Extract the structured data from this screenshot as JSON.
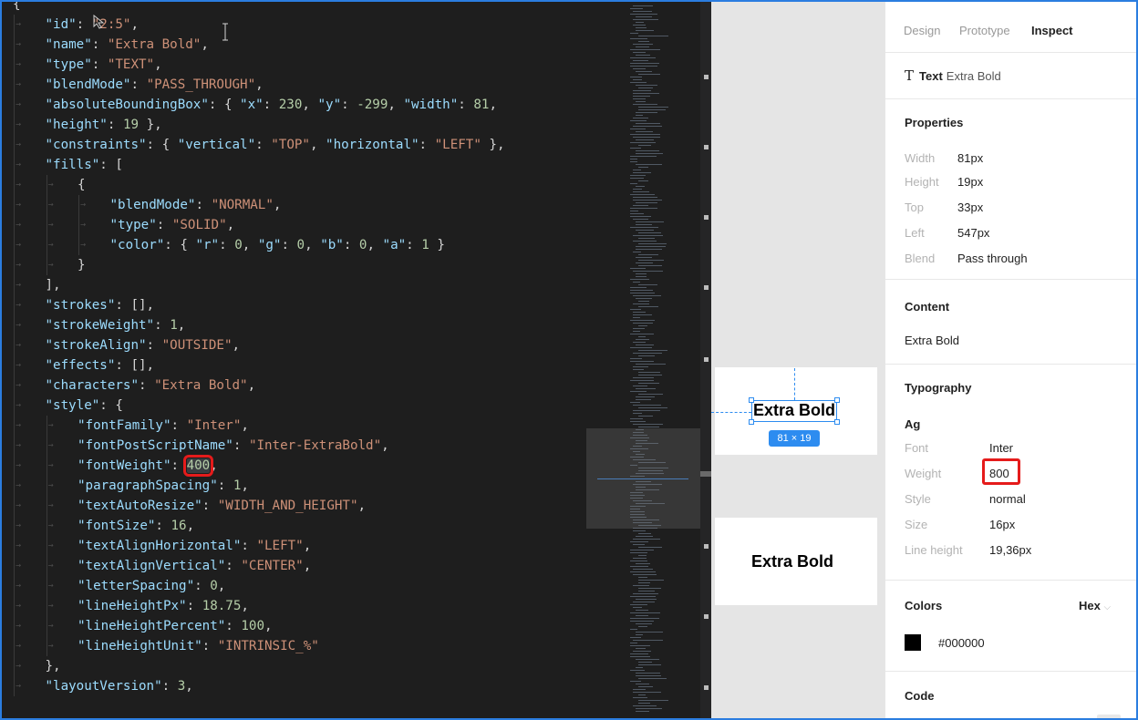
{
  "editor": {
    "lines": [
      {
        "indent": 0,
        "tokens": [
          [
            "{",
            "p"
          ]
        ]
      },
      {
        "indent": 1,
        "tokens": [
          [
            "\"id\"",
            "k"
          ],
          [
            ": ",
            "p"
          ],
          [
            "\"2:5\"",
            "s"
          ],
          [
            ",",
            "p"
          ]
        ]
      },
      {
        "indent": 1,
        "tokens": [
          [
            "\"name\"",
            "k"
          ],
          [
            ": ",
            "p"
          ],
          [
            "\"Extra Bold\"",
            "s"
          ],
          [
            ",",
            "p"
          ]
        ]
      },
      {
        "indent": 1,
        "tokens": [
          [
            "\"type\"",
            "k"
          ],
          [
            ": ",
            "p"
          ],
          [
            "\"TEXT\"",
            "s"
          ],
          [
            ",",
            "p"
          ]
        ]
      },
      {
        "indent": 1,
        "tokens": [
          [
            "\"blendMode\"",
            "k"
          ],
          [
            ": ",
            "p"
          ],
          [
            "\"PASS_THROUGH\"",
            "s"
          ],
          [
            ",",
            "p"
          ]
        ]
      },
      {
        "indent": 1,
        "tokens": [
          [
            "\"absoluteBoundingBox\"",
            "k"
          ],
          [
            ": { ",
            "p"
          ],
          [
            "\"x\"",
            "k"
          ],
          [
            ": ",
            "p"
          ],
          [
            "230",
            "n"
          ],
          [
            ", ",
            "p"
          ],
          [
            "\"y\"",
            "k"
          ],
          [
            ": ",
            "p"
          ],
          [
            "-299",
            "n"
          ],
          [
            ", ",
            "p"
          ],
          [
            "\"width\"",
            "k"
          ],
          [
            ": ",
            "p"
          ],
          [
            "81",
            "n"
          ],
          [
            ",",
            "p"
          ]
        ]
      },
      {
        "indent": 1,
        "tokens": [
          [
            "\"height\"",
            "k"
          ],
          [
            ": ",
            "p"
          ],
          [
            "19",
            "n"
          ],
          [
            " },",
            "p"
          ]
        ]
      },
      {
        "indent": 1,
        "tokens": [
          [
            "\"constraints\"",
            "k"
          ],
          [
            ": { ",
            "p"
          ],
          [
            "\"vertical\"",
            "k"
          ],
          [
            ": ",
            "p"
          ],
          [
            "\"TOP\"",
            "s"
          ],
          [
            ", ",
            "p"
          ],
          [
            "\"horizontal\"",
            "k"
          ],
          [
            ": ",
            "p"
          ],
          [
            "\"LEFT\"",
            "s"
          ],
          [
            " },",
            "p"
          ]
        ]
      },
      {
        "indent": 1,
        "tokens": [
          [
            "\"fills\"",
            "k"
          ],
          [
            ": [",
            "p"
          ]
        ]
      },
      {
        "indent": 2,
        "tokens": [
          [
            "{",
            "p"
          ]
        ]
      },
      {
        "indent": 3,
        "tokens": [
          [
            "\"blendMode\"",
            "k"
          ],
          [
            ": ",
            "p"
          ],
          [
            "\"NORMAL\"",
            "s"
          ],
          [
            ",",
            "p"
          ]
        ]
      },
      {
        "indent": 3,
        "tokens": [
          [
            "\"type\"",
            "k"
          ],
          [
            ": ",
            "p"
          ],
          [
            "\"SOLID\"",
            "s"
          ],
          [
            ",",
            "p"
          ]
        ]
      },
      {
        "indent": 3,
        "tokens": [
          [
            "\"color\"",
            "k"
          ],
          [
            ": { ",
            "p"
          ],
          [
            "\"r\"",
            "k"
          ],
          [
            ": ",
            "p"
          ],
          [
            "0",
            "n"
          ],
          [
            ", ",
            "p"
          ],
          [
            "\"g\"",
            "k"
          ],
          [
            ": ",
            "p"
          ],
          [
            "0",
            "n"
          ],
          [
            ", ",
            "p"
          ],
          [
            "\"b\"",
            "k"
          ],
          [
            ": ",
            "p"
          ],
          [
            "0",
            "n"
          ],
          [
            ", ",
            "p"
          ],
          [
            "\"a\"",
            "k"
          ],
          [
            ": ",
            "p"
          ],
          [
            "1",
            "n"
          ],
          [
            " }",
            "p"
          ]
        ]
      },
      {
        "indent": 2,
        "tokens": [
          [
            "}",
            "p"
          ]
        ]
      },
      {
        "indent": 1,
        "tokens": [
          [
            "],",
            "p"
          ]
        ]
      },
      {
        "indent": 1,
        "tokens": [
          [
            "\"strokes\"",
            "k"
          ],
          [
            ": [],",
            "p"
          ]
        ]
      },
      {
        "indent": 1,
        "tokens": [
          [
            "\"strokeWeight\"",
            "k"
          ],
          [
            ": ",
            "p"
          ],
          [
            "1",
            "n"
          ],
          [
            ",",
            "p"
          ]
        ]
      },
      {
        "indent": 1,
        "tokens": [
          [
            "\"strokeAlign\"",
            "k"
          ],
          [
            ": ",
            "p"
          ],
          [
            "\"OUTSIDE\"",
            "s"
          ],
          [
            ",",
            "p"
          ]
        ]
      },
      {
        "indent": 1,
        "tokens": [
          [
            "\"effects\"",
            "k"
          ],
          [
            ": [],",
            "p"
          ]
        ]
      },
      {
        "indent": 1,
        "tokens": [
          [
            "\"characters\"",
            "k"
          ],
          [
            ": ",
            "p"
          ],
          [
            "\"Extra Bold\"",
            "s"
          ],
          [
            ",",
            "p"
          ]
        ]
      },
      {
        "indent": 1,
        "tokens": [
          [
            "\"style\"",
            "k"
          ],
          [
            ": {",
            "p"
          ]
        ]
      },
      {
        "indent": 2,
        "tokens": [
          [
            "\"fontFamily\"",
            "k"
          ],
          [
            ": ",
            "p"
          ],
          [
            "\"Inter\"",
            "s"
          ],
          [
            ",",
            "p"
          ]
        ]
      },
      {
        "indent": 2,
        "tokens": [
          [
            "\"fontPostScriptName\"",
            "k"
          ],
          [
            ": ",
            "p"
          ],
          [
            "\"Inter-ExtraBold\"",
            "s"
          ],
          [
            ",",
            "p"
          ]
        ]
      },
      {
        "indent": 2,
        "tokens": [
          [
            "\"fontWeight\"",
            "k"
          ],
          [
            ": ",
            "p"
          ],
          [
            "400",
            "n",
            "hl"
          ],
          [
            ",",
            "p"
          ]
        ]
      },
      {
        "indent": 2,
        "tokens": [
          [
            "\"paragraphSpacing\"",
            "k"
          ],
          [
            ": ",
            "p"
          ],
          [
            "1",
            "n"
          ],
          [
            ",",
            "p"
          ]
        ]
      },
      {
        "indent": 2,
        "tokens": [
          [
            "\"textAutoResize\"",
            "k"
          ],
          [
            ": ",
            "p"
          ],
          [
            "\"WIDTH_AND_HEIGHT\"",
            "s"
          ],
          [
            ",",
            "p"
          ]
        ]
      },
      {
        "indent": 2,
        "tokens": [
          [
            "\"fontSize\"",
            "k"
          ],
          [
            ": ",
            "p"
          ],
          [
            "16",
            "n"
          ],
          [
            ",",
            "p"
          ]
        ]
      },
      {
        "indent": 2,
        "tokens": [
          [
            "\"textAlignHorizontal\"",
            "k"
          ],
          [
            ": ",
            "p"
          ],
          [
            "\"LEFT\"",
            "s"
          ],
          [
            ",",
            "p"
          ]
        ]
      },
      {
        "indent": 2,
        "tokens": [
          [
            "\"textAlignVertical\"",
            "k"
          ],
          [
            ": ",
            "p"
          ],
          [
            "\"CENTER\"",
            "s"
          ],
          [
            ",",
            "p"
          ]
        ]
      },
      {
        "indent": 2,
        "tokens": [
          [
            "\"letterSpacing\"",
            "k"
          ],
          [
            ": ",
            "p"
          ],
          [
            "0",
            "n"
          ],
          [
            ",",
            "p"
          ]
        ]
      },
      {
        "indent": 2,
        "tokens": [
          [
            "\"lineHeightPx\"",
            "k"
          ],
          [
            ": ",
            "p"
          ],
          [
            "18.75",
            "n"
          ],
          [
            ",",
            "p"
          ]
        ]
      },
      {
        "indent": 2,
        "tokens": [
          [
            "\"lineHeightPercent\"",
            "k"
          ],
          [
            ": ",
            "p"
          ],
          [
            "100",
            "n"
          ],
          [
            ",",
            "p"
          ]
        ]
      },
      {
        "indent": 2,
        "tokens": [
          [
            "\"lineHeightUnit\"",
            "k"
          ],
          [
            ": ",
            "p"
          ],
          [
            "\"INTRINSIC_%\"",
            "s"
          ]
        ]
      },
      {
        "indent": 1,
        "tokens": [
          [
            "},",
            "p"
          ]
        ]
      },
      {
        "indent": 1,
        "tokens": [
          [
            "\"layoutVersion\"",
            "k"
          ],
          [
            ": ",
            "p"
          ],
          [
            "3",
            "n"
          ],
          [
            ",",
            "p"
          ]
        ]
      }
    ]
  },
  "canvas": {
    "text_selected": "Extra Bold",
    "text_plain": "Extra Bold",
    "dimension_badge": "81 × 19"
  },
  "panel": {
    "tabs": [
      "Design",
      "Prototype",
      "Inspect"
    ],
    "active_tab": "Inspect",
    "layer_type": "Text",
    "layer_name": "Extra Bold",
    "properties": {
      "title": "Properties",
      "rows": [
        {
          "label": "Width",
          "value": "81px"
        },
        {
          "label": "Height",
          "value": "19px"
        },
        {
          "label": "Top",
          "value": "33px"
        },
        {
          "label": "Left",
          "value": "547px"
        },
        {
          "label": "Blend",
          "value": "Pass through"
        }
      ]
    },
    "content": {
      "title": "Content",
      "value": "Extra Bold"
    },
    "typography": {
      "title": "Typography",
      "sample": "Ag",
      "rows": [
        {
          "label": "Font",
          "value": "Inter"
        },
        {
          "label": "Weight",
          "value": "800"
        },
        {
          "label": "Style",
          "value": "normal"
        },
        {
          "label": "Size",
          "value": "16px"
        },
        {
          "label": "Line height",
          "value": "19,36px"
        }
      ]
    },
    "colors": {
      "title": "Colors",
      "format": "Hex",
      "swatch_color": "#000000",
      "value": "#000000"
    },
    "code": {
      "title": "Code"
    }
  },
  "colors": {
    "highlight": "#e51b1b",
    "selection": "#2d8cf0"
  }
}
